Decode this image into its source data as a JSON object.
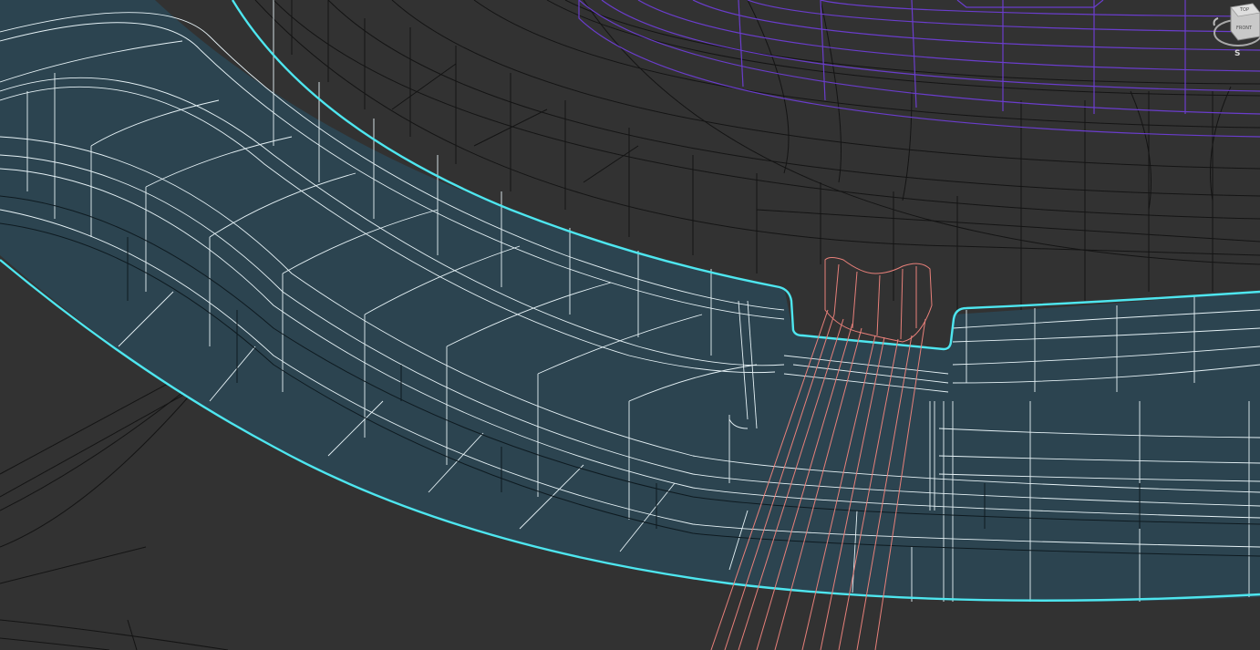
{
  "viewport": {
    "background": "#323232",
    "shading": "wireframe-over-shaded",
    "colors": {
      "selected_face": "#2c4450",
      "selected_edge": "#e8f4f8",
      "selection_outline": "#4ee6ef",
      "dark_wire": "#101010",
      "violet_wire": "#6a3dcc",
      "pink_wire": "#e8807a"
    }
  },
  "viewcube": {
    "face_label": "FRONT",
    "top_label": "TOP",
    "compass_label": "S"
  }
}
